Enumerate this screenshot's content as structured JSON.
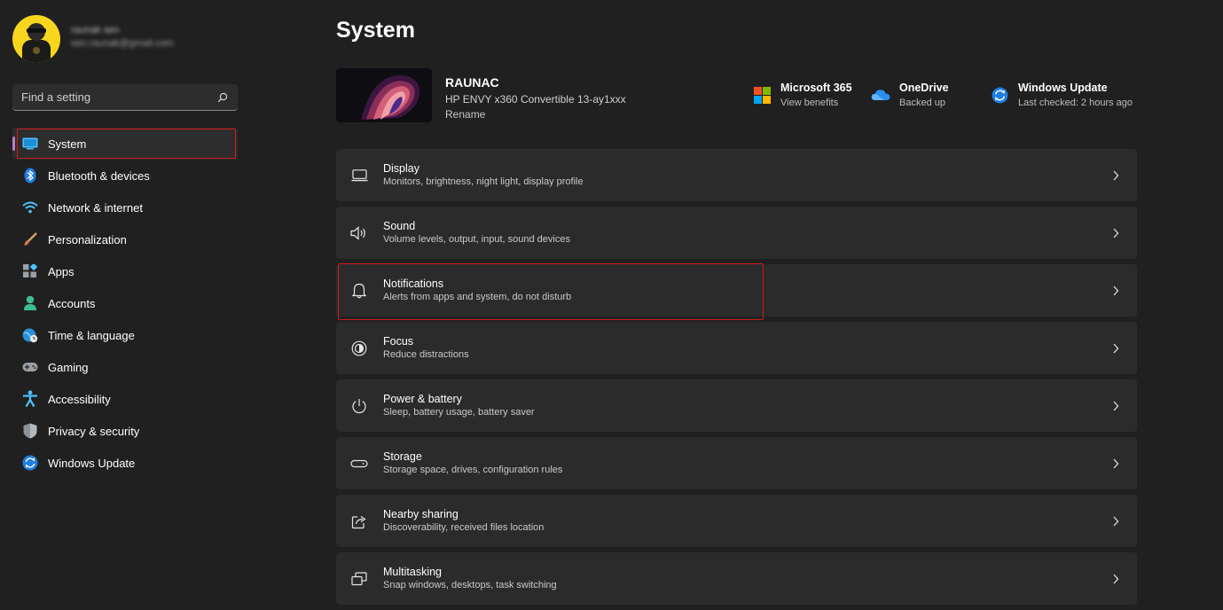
{
  "profile": {
    "name": "raunak sen",
    "email": "sen.raunak@gmail.com"
  },
  "search": {
    "placeholder": "Find a setting"
  },
  "sidebar": {
    "items": [
      {
        "label": "System",
        "icon": "system-icon",
        "active": true
      },
      {
        "label": "Bluetooth & devices",
        "icon": "bluetooth-icon"
      },
      {
        "label": "Network & internet",
        "icon": "wifi-icon"
      },
      {
        "label": "Personalization",
        "icon": "brush-icon"
      },
      {
        "label": "Apps",
        "icon": "apps-icon"
      },
      {
        "label": "Accounts",
        "icon": "person-icon"
      },
      {
        "label": "Time & language",
        "icon": "globe-clock-icon"
      },
      {
        "label": "Gaming",
        "icon": "gamepad-icon"
      },
      {
        "label": "Accessibility",
        "icon": "accessibility-icon"
      },
      {
        "label": "Privacy & security",
        "icon": "shield-icon"
      },
      {
        "label": "Windows Update",
        "icon": "update-icon"
      }
    ]
  },
  "main": {
    "title": "System",
    "device": {
      "name": "RAUNAC",
      "model": "HP ENVY x360 Convertible 13-ay1xxx",
      "rename": "Rename"
    },
    "quick_links": [
      {
        "title": "Microsoft 365",
        "sub": "View benefits",
        "icon": "microsoft-logo-icon"
      },
      {
        "title": "OneDrive",
        "sub": "Backed up",
        "icon": "cloud-icon"
      },
      {
        "title": "Windows Update",
        "sub": "Last checked: 2 hours ago",
        "icon": "update-icon"
      }
    ],
    "cards": [
      {
        "title": "Display",
        "sub": "Monitors, brightness, night light, display profile",
        "icon": "monitor-icon"
      },
      {
        "title": "Sound",
        "sub": "Volume levels, output, input, sound devices",
        "icon": "speaker-icon"
      },
      {
        "title": "Notifications",
        "sub": "Alerts from apps and system, do not disturb",
        "icon": "bell-icon"
      },
      {
        "title": "Focus",
        "sub": "Reduce distractions",
        "icon": "focus-icon"
      },
      {
        "title": "Power & battery",
        "sub": "Sleep, battery usage, battery saver",
        "icon": "power-icon"
      },
      {
        "title": "Storage",
        "sub": "Storage space, drives, configuration rules",
        "icon": "storage-icon"
      },
      {
        "title": "Nearby sharing",
        "sub": "Discoverability, received files location",
        "icon": "share-icon"
      },
      {
        "title": "Multitasking",
        "sub": "Snap windows, desktops, task switching",
        "icon": "multitask-icon"
      }
    ]
  },
  "colors": {
    "background": "#202020",
    "card": "#2b2b2b",
    "accent": "#b77ec9",
    "highlight": "#d11a1a",
    "avatar": "#f7d61d"
  }
}
